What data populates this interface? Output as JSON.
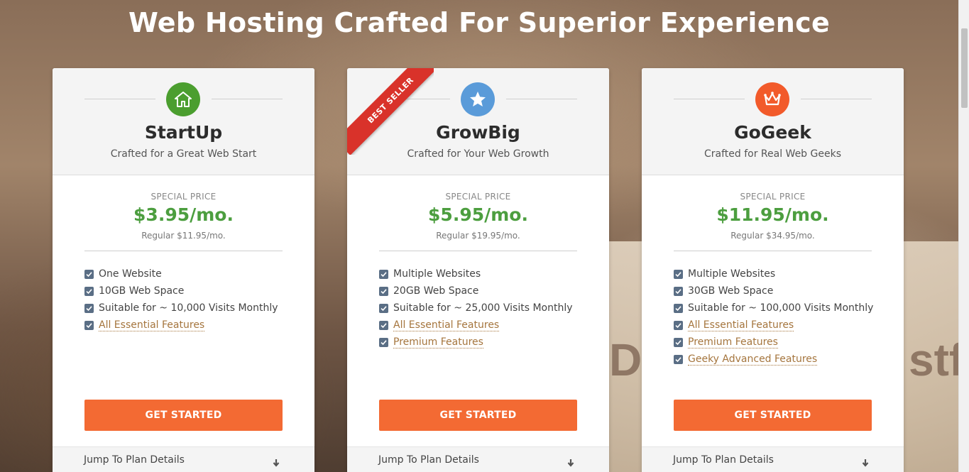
{
  "headline": "Web Hosting Crafted For Superior Experience",
  "background_text": {
    "left": "De",
    "right": "stf"
  },
  "colors": {
    "price_green": "#4c9e3f",
    "cta_orange": "#f36a33",
    "feature_link": "#a5753d",
    "checkbox": "#5a6e85",
    "ribbon_red": "#d9322a"
  },
  "plans": [
    {
      "name": "StartUp",
      "tagline": "Crafted for a Great Web Start",
      "icon": "house-icon",
      "icon_color": "#4b9e2f",
      "special_label": "SPECIAL PRICE",
      "price": "$3.95/mo.",
      "regular": "Regular $11.95/mo.",
      "features": [
        {
          "text": "One Website",
          "link": false
        },
        {
          "text": "10GB Web Space",
          "link": false
        },
        {
          "text": "Suitable for ~ 10,000 Visits Monthly",
          "link": false
        },
        {
          "text": "All Essential Features",
          "link": true
        }
      ],
      "cta": "GET STARTED",
      "jump": "Jump To Plan Details"
    },
    {
      "name": "GrowBig",
      "tagline": "Crafted for Your Web Growth",
      "icon": "star-icon",
      "icon_color": "#5a9bd9",
      "ribbon": "BEST SELLER",
      "special_label": "SPECIAL PRICE",
      "price": "$5.95/mo.",
      "regular": "Regular $19.95/mo.",
      "features": [
        {
          "text": "Multiple Websites",
          "link": false
        },
        {
          "text": "20GB Web Space",
          "link": false
        },
        {
          "text": "Suitable for ~ 25,000 Visits Monthly",
          "link": false
        },
        {
          "text": "All Essential Features",
          "link": true
        },
        {
          "text": "Premium Features",
          "link": true
        }
      ],
      "cta": "GET STARTED",
      "jump": "Jump To Plan Details"
    },
    {
      "name": "GoGeek",
      "tagline": "Crafted for Real Web Geeks",
      "icon": "crown-icon",
      "icon_color": "#f25a2a",
      "special_label": "SPECIAL PRICE",
      "price": "$11.95/mo.",
      "regular": "Regular $34.95/mo.",
      "features": [
        {
          "text": "Multiple Websites",
          "link": false
        },
        {
          "text": "30GB Web Space",
          "link": false
        },
        {
          "text": "Suitable for ~ 100,000 Visits Monthly",
          "link": false
        },
        {
          "text": "All Essential Features",
          "link": true
        },
        {
          "text": "Premium Features",
          "link": true
        },
        {
          "text": "Geeky Advanced Features",
          "link": true
        }
      ],
      "cta": "GET STARTED",
      "jump": "Jump To Plan Details"
    }
  ]
}
